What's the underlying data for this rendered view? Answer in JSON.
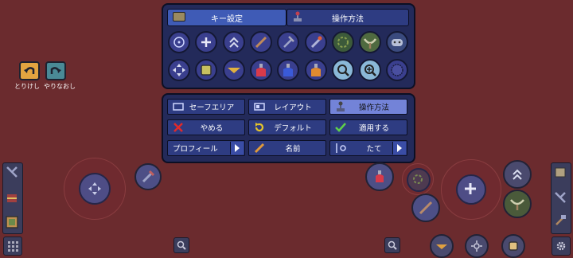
{
  "top_panel": {
    "tabs": [
      {
        "label": "キー設定",
        "icon": "keyboard-icon",
        "active": true
      },
      {
        "label": "操作方法",
        "icon": "joystick-icon",
        "active": false
      }
    ],
    "row1_icons": [
      "target-icon",
      "plus-icon",
      "double-chevron-up-icon",
      "sword-icon",
      "pickaxe-icon",
      "rocket-icon",
      "rope-icon",
      "pickaxe-hook-icon",
      "gamepad-icon"
    ],
    "row2_icons": [
      "dpad-icon",
      "square-icon",
      "ufo-icon",
      "healing-potion-icon",
      "mana-potion-icon",
      "buff-potion-icon",
      "zoom-out-icon",
      "zoom-in-icon",
      "circle-icon"
    ]
  },
  "menu": {
    "buttons": [
      {
        "label": "セーフエリア",
        "icon": "screen-icon"
      },
      {
        "label": "レイアウト",
        "icon": "layout-icon"
      },
      {
        "label": "操作方法",
        "icon": "joystick-icon",
        "selected": true
      },
      {
        "label": "やめる",
        "icon": "x-icon",
        "color": "#e02a2a"
      },
      {
        "label": "デフォルト",
        "icon": "reset-icon",
        "color": "#e6c52a"
      },
      {
        "label": "適用する",
        "icon": "check-icon",
        "color": "#5fd04a"
      },
      {
        "label": "プロフィール",
        "icon": "arrow-right-icon"
      },
      {
        "label": "名前",
        "icon": "pencil-icon"
      },
      {
        "label": "たて",
        "icon": "vertical-icon"
      }
    ]
  },
  "undo": {
    "label": "とりけし"
  },
  "redo": {
    "label": "やりなおし"
  },
  "colors": {
    "background": "#6b2b2e",
    "panel": "#232a5a",
    "accent": "#3f5bb6"
  }
}
